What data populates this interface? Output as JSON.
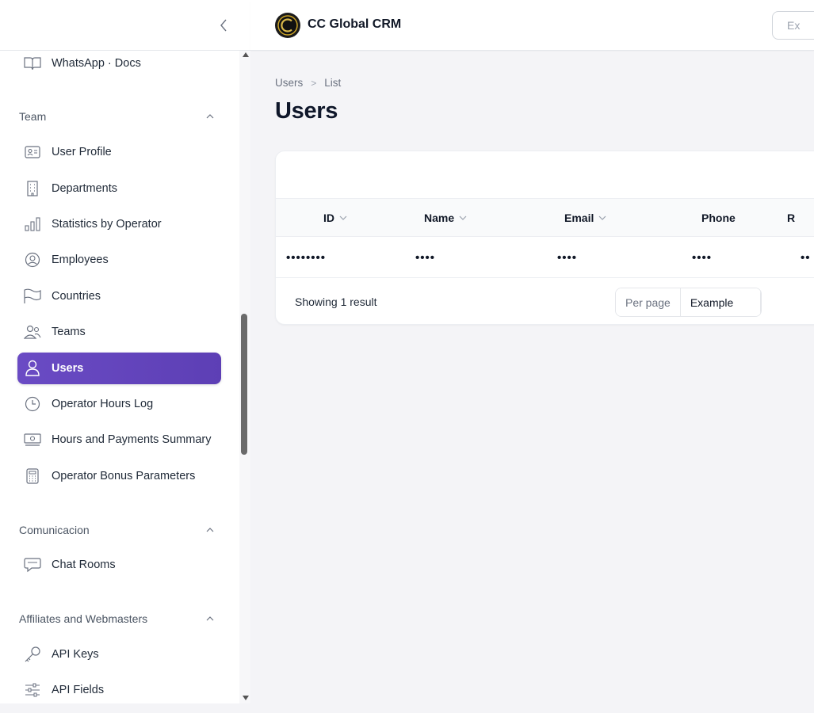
{
  "app": {
    "brand": "CC Global CRM"
  },
  "search": {
    "placeholder": "Ex"
  },
  "sidebar": {
    "top_item": {
      "label": "WhatsApp · Docs",
      "icon": "book-icon"
    },
    "groups": [
      {
        "label": "Team",
        "items": [
          {
            "label": "User Profile",
            "icon": "id-card-icon"
          },
          {
            "label": "Departments",
            "icon": "building-icon"
          },
          {
            "label": "Statistics by Operator",
            "icon": "bar-chart-icon"
          },
          {
            "label": "Employees",
            "icon": "user-circle-icon"
          },
          {
            "label": "Countries",
            "icon": "flag-icon"
          },
          {
            "label": "Teams",
            "icon": "users-icon"
          },
          {
            "label": "Users",
            "icon": "user-icon",
            "active": true
          },
          {
            "label": "Operator Hours Log",
            "icon": "clock-icon"
          },
          {
            "label": "Hours and Payments Summary",
            "icon": "cash-icon"
          },
          {
            "label": "Operator Bonus Parameters",
            "icon": "calculator-icon"
          }
        ]
      },
      {
        "label": "Comunicacion",
        "items": [
          {
            "label": "Chat Rooms",
            "icon": "chat-bubbles-icon"
          }
        ]
      },
      {
        "label": "Affiliates and Webmasters",
        "items": [
          {
            "label": "API Keys",
            "icon": "key-icon"
          },
          {
            "label": "API Fields",
            "icon": "sliders-icon"
          }
        ]
      }
    ]
  },
  "breadcrumb": {
    "root": "Users",
    "separator": ">",
    "current": "List"
  },
  "page": {
    "title": "Users"
  },
  "table": {
    "columns": [
      "ID",
      "Name",
      "Email",
      "Phone",
      "R"
    ],
    "rows": [
      [
        "••••••••",
        "••••",
        "••••",
        "••••",
        "••"
      ]
    ],
    "footer": {
      "showing": "Showing 1 result",
      "per_page_label": "Per page",
      "per_page_value": "Example"
    }
  },
  "colors": {
    "accent": "#6a4bc4",
    "logo_ring": "#c9a227"
  }
}
